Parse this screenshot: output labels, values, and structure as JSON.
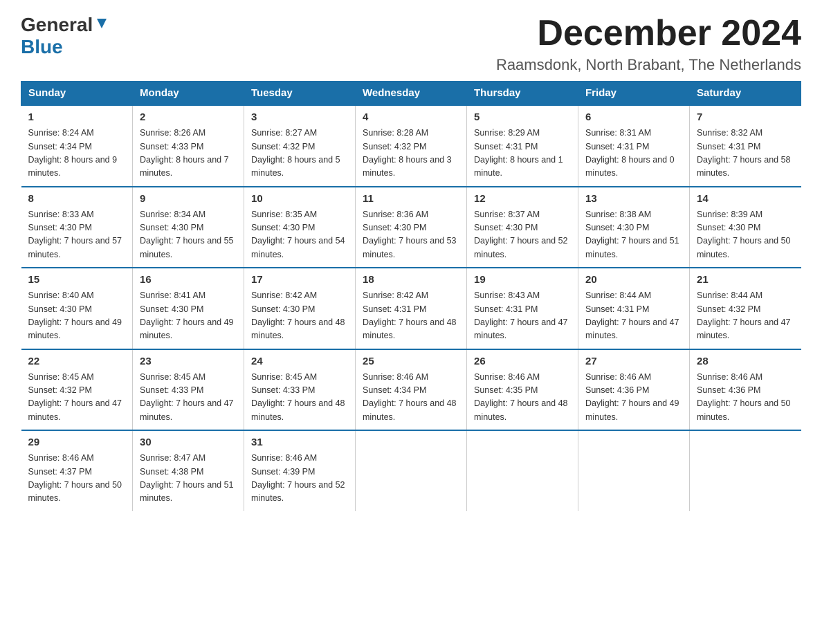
{
  "header": {
    "logo_general": "General",
    "logo_blue": "Blue",
    "month_title": "December 2024",
    "location": "Raamsdonk, North Brabant, The Netherlands"
  },
  "days_of_week": [
    "Sunday",
    "Monday",
    "Tuesday",
    "Wednesday",
    "Thursday",
    "Friday",
    "Saturday"
  ],
  "weeks": [
    [
      {
        "day": "1",
        "sunrise": "8:24 AM",
        "sunset": "4:34 PM",
        "daylight": "8 hours and 9 minutes."
      },
      {
        "day": "2",
        "sunrise": "8:26 AM",
        "sunset": "4:33 PM",
        "daylight": "8 hours and 7 minutes."
      },
      {
        "day": "3",
        "sunrise": "8:27 AM",
        "sunset": "4:32 PM",
        "daylight": "8 hours and 5 minutes."
      },
      {
        "day": "4",
        "sunrise": "8:28 AM",
        "sunset": "4:32 PM",
        "daylight": "8 hours and 3 minutes."
      },
      {
        "day": "5",
        "sunrise": "8:29 AM",
        "sunset": "4:31 PM",
        "daylight": "8 hours and 1 minute."
      },
      {
        "day": "6",
        "sunrise": "8:31 AM",
        "sunset": "4:31 PM",
        "daylight": "8 hours and 0 minutes."
      },
      {
        "day": "7",
        "sunrise": "8:32 AM",
        "sunset": "4:31 PM",
        "daylight": "7 hours and 58 minutes."
      }
    ],
    [
      {
        "day": "8",
        "sunrise": "8:33 AM",
        "sunset": "4:30 PM",
        "daylight": "7 hours and 57 minutes."
      },
      {
        "day": "9",
        "sunrise": "8:34 AM",
        "sunset": "4:30 PM",
        "daylight": "7 hours and 55 minutes."
      },
      {
        "day": "10",
        "sunrise": "8:35 AM",
        "sunset": "4:30 PM",
        "daylight": "7 hours and 54 minutes."
      },
      {
        "day": "11",
        "sunrise": "8:36 AM",
        "sunset": "4:30 PM",
        "daylight": "7 hours and 53 minutes."
      },
      {
        "day": "12",
        "sunrise": "8:37 AM",
        "sunset": "4:30 PM",
        "daylight": "7 hours and 52 minutes."
      },
      {
        "day": "13",
        "sunrise": "8:38 AM",
        "sunset": "4:30 PM",
        "daylight": "7 hours and 51 minutes."
      },
      {
        "day": "14",
        "sunrise": "8:39 AM",
        "sunset": "4:30 PM",
        "daylight": "7 hours and 50 minutes."
      }
    ],
    [
      {
        "day": "15",
        "sunrise": "8:40 AM",
        "sunset": "4:30 PM",
        "daylight": "7 hours and 49 minutes."
      },
      {
        "day": "16",
        "sunrise": "8:41 AM",
        "sunset": "4:30 PM",
        "daylight": "7 hours and 49 minutes."
      },
      {
        "day": "17",
        "sunrise": "8:42 AM",
        "sunset": "4:30 PM",
        "daylight": "7 hours and 48 minutes."
      },
      {
        "day": "18",
        "sunrise": "8:42 AM",
        "sunset": "4:31 PM",
        "daylight": "7 hours and 48 minutes."
      },
      {
        "day": "19",
        "sunrise": "8:43 AM",
        "sunset": "4:31 PM",
        "daylight": "7 hours and 47 minutes."
      },
      {
        "day": "20",
        "sunrise": "8:44 AM",
        "sunset": "4:31 PM",
        "daylight": "7 hours and 47 minutes."
      },
      {
        "day": "21",
        "sunrise": "8:44 AM",
        "sunset": "4:32 PM",
        "daylight": "7 hours and 47 minutes."
      }
    ],
    [
      {
        "day": "22",
        "sunrise": "8:45 AM",
        "sunset": "4:32 PM",
        "daylight": "7 hours and 47 minutes."
      },
      {
        "day": "23",
        "sunrise": "8:45 AM",
        "sunset": "4:33 PM",
        "daylight": "7 hours and 47 minutes."
      },
      {
        "day": "24",
        "sunrise": "8:45 AM",
        "sunset": "4:33 PM",
        "daylight": "7 hours and 48 minutes."
      },
      {
        "day": "25",
        "sunrise": "8:46 AM",
        "sunset": "4:34 PM",
        "daylight": "7 hours and 48 minutes."
      },
      {
        "day": "26",
        "sunrise": "8:46 AM",
        "sunset": "4:35 PM",
        "daylight": "7 hours and 48 minutes."
      },
      {
        "day": "27",
        "sunrise": "8:46 AM",
        "sunset": "4:36 PM",
        "daylight": "7 hours and 49 minutes."
      },
      {
        "day": "28",
        "sunrise": "8:46 AM",
        "sunset": "4:36 PM",
        "daylight": "7 hours and 50 minutes."
      }
    ],
    [
      {
        "day": "29",
        "sunrise": "8:46 AM",
        "sunset": "4:37 PM",
        "daylight": "7 hours and 50 minutes."
      },
      {
        "day": "30",
        "sunrise": "8:47 AM",
        "sunset": "4:38 PM",
        "daylight": "7 hours and 51 minutes."
      },
      {
        "day": "31",
        "sunrise": "8:46 AM",
        "sunset": "4:39 PM",
        "daylight": "7 hours and 52 minutes."
      },
      null,
      null,
      null,
      null
    ]
  ]
}
